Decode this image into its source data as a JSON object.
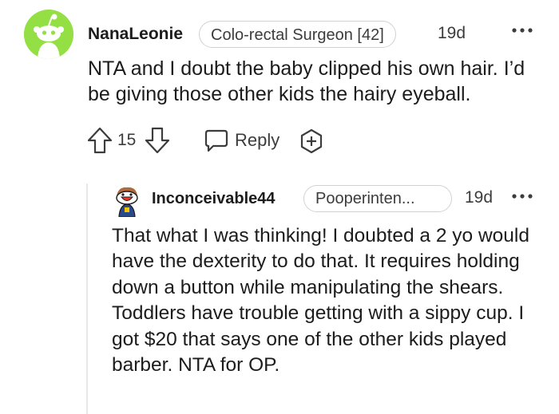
{
  "parent_comment": {
    "username": "NanaLeonie",
    "flair": "Colo-rectal Surgeon [42]",
    "age": "19d",
    "body": "NTA and I doubt the baby clipped his own hair. I’d be giving those other kids the hairy eyeball.",
    "score": "15",
    "reply_label": "Reply",
    "avatar_color": "#94e044"
  },
  "child_comment": {
    "username": "Inconceivable44",
    "flair": "Pooperinten...",
    "age": "19d",
    "body": "That what I was thinking! I doubted a 2 yo would have the dexterity to do that. It requires holding down a button while manipulating the shears. Toddlers have trouble getting with a sippy cup. I got $20 that says one of the other kids played barber. NTA for OP."
  },
  "icons": {
    "upvote": "arrow-up-icon",
    "downvote": "arrow-down-icon",
    "reply": "speech-bubble-icon",
    "award": "award-plus-icon",
    "more": "more-dots-icon"
  }
}
